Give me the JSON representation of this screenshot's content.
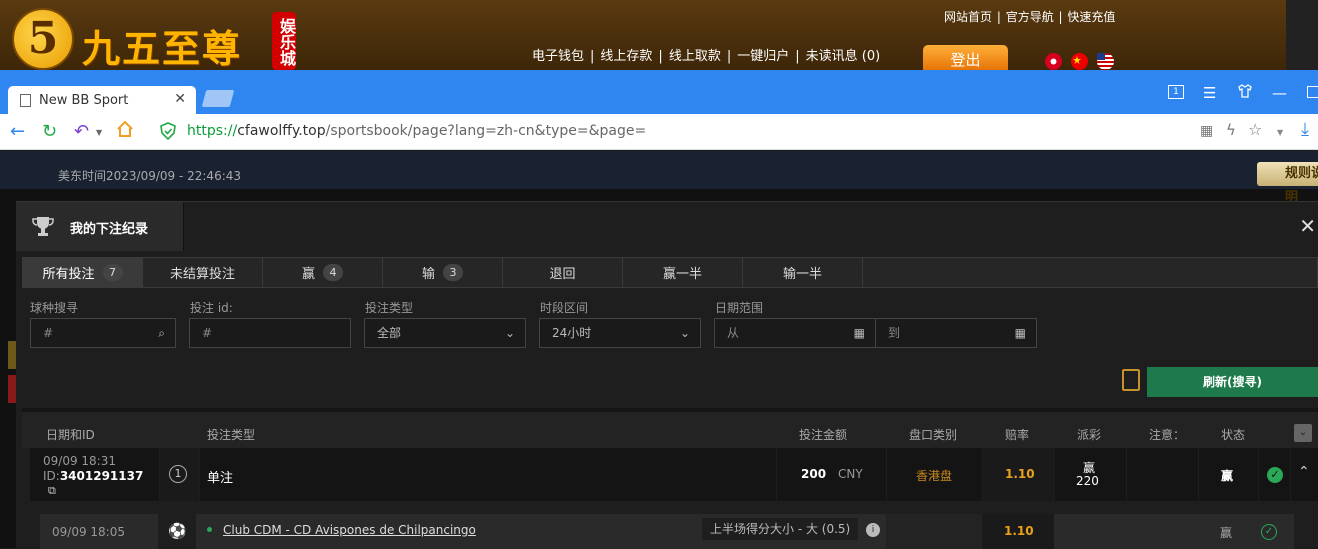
{
  "site": {
    "logo_glyph": "5",
    "logo_text": "九五至尊",
    "logo_badge": "娱乐城",
    "top_links": [
      "网站首页",
      "官方导航",
      "快速充值"
    ],
    "nav_links": [
      "电子钱包",
      "线上存款",
      "线上取款",
      "一键归户",
      "未读讯息 (0)"
    ],
    "login_button": "登出"
  },
  "browser": {
    "tab_title": "New BB Sport",
    "url_scheme": "https://",
    "url_host": "cfawolffy.top",
    "url_path": "/sportsbook/page?lang=zh-cn&type=&page="
  },
  "page": {
    "time_text": "美东时间2023/09/09 - 22:46:43",
    "rules_button": "规则说明"
  },
  "modal": {
    "title": "我的下注纪录",
    "tabs": [
      {
        "label": "所有投注",
        "count": "7"
      },
      {
        "label": "未结算投注",
        "count": ""
      },
      {
        "label": "赢",
        "count": "4"
      },
      {
        "label": "输",
        "count": "3"
      },
      {
        "label": "退回",
        "count": ""
      },
      {
        "label": "赢一半",
        "count": ""
      },
      {
        "label": "输一半",
        "count": ""
      }
    ],
    "filters": {
      "sport_label": "球种搜寻",
      "sport_placeholder": "#",
      "betid_label": "投注 id:",
      "betid_placeholder": "#",
      "bettype_label": "投注类型",
      "bettype_value": "全部",
      "period_label": "时段区间",
      "period_value": "24小时",
      "date_label": "日期范围",
      "date_from": "从",
      "date_to": "到"
    },
    "refresh_button": "刷新(搜寻)",
    "columns": [
      "日期和ID",
      "投注类型",
      "投注金额",
      "盘口类别",
      "赔率",
      "派彩",
      "注意：",
      "状态"
    ],
    "bet": {
      "date": "09/09 18:31",
      "id_label": "ID:",
      "id": "3401291137",
      "index": "1",
      "type": "单注",
      "amount": "200",
      "currency": "CNY",
      "market": "香港盘",
      "odds": "1.10",
      "payout_label": "赢",
      "payout_value": "220",
      "status": "赢"
    },
    "selection": {
      "date": "09/09 18:05",
      "match": "Club CDM - CD Avispones de Chilpancingo",
      "market_desc": "上半场得分大小 - 大 (0.5)",
      "odds": "1.10",
      "status": "赢"
    }
  }
}
